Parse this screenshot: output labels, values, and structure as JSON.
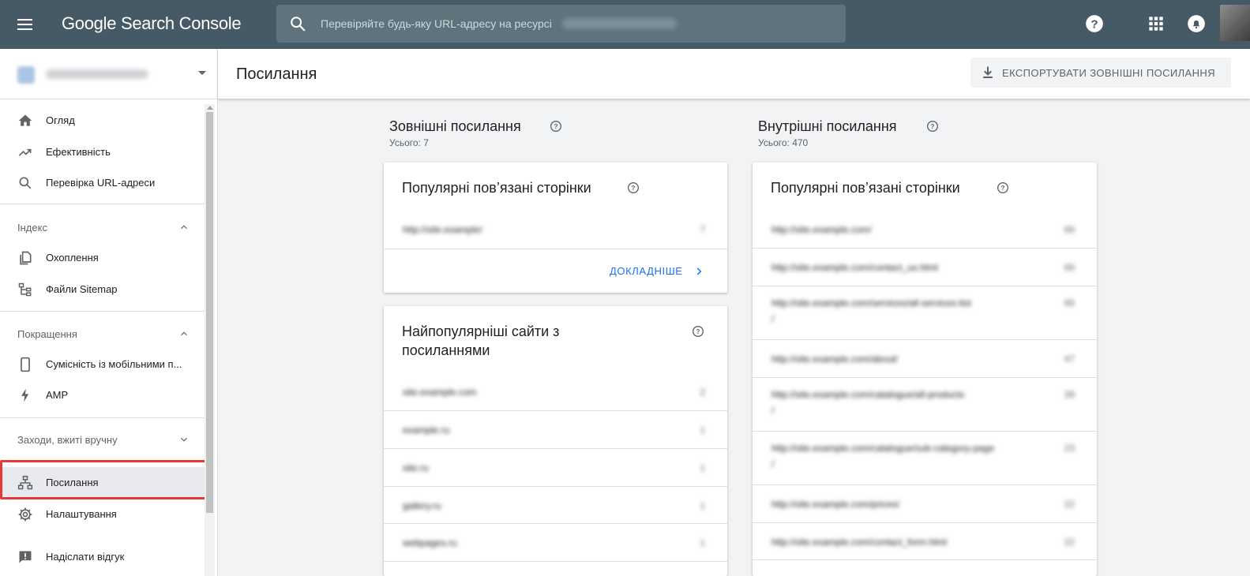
{
  "topbar": {
    "product_name": "Google Search Console",
    "search_placeholder": "Перевіряйте будь-яку URL-адресу на ресурсі"
  },
  "sidebar": {
    "items_main": [
      {
        "label": "Огляд",
        "icon": "home-icon"
      },
      {
        "label": "Ефективність",
        "icon": "trending-up-icon"
      },
      {
        "label": "Перевірка URL-адреси",
        "icon": "search-icon"
      }
    ],
    "section_index": {
      "label": "Індекс",
      "items": [
        {
          "label": "Охоплення",
          "icon": "copy-pages-icon"
        },
        {
          "label": "Файли Sitemap",
          "icon": "sitemap-icon"
        }
      ]
    },
    "section_enhancements": {
      "label": "Покращення",
      "items": [
        {
          "label": "Сумісність із мобільними п...",
          "icon": "smartphone-icon"
        },
        {
          "label": "AMP",
          "icon": "bolt-icon"
        }
      ]
    },
    "section_manual": {
      "label": "Заходи, вжиті вручну"
    },
    "items_bottom": [
      {
        "label": "Посилання",
        "icon": "links-icon",
        "active": true
      },
      {
        "label": "Налаштування",
        "icon": "gear-icon"
      },
      {
        "label": "Надіслати відгук",
        "icon": "feedback-icon"
      }
    ]
  },
  "page": {
    "title": "Посилання",
    "export_label": "ЕКСПОРТУВАТИ ЗОВНІШНІ ПОСИЛАННЯ"
  },
  "external": {
    "title": "Зовнішні посилання",
    "total": "Усього: 7",
    "top_pages": {
      "title": "Популярні пов’язані сторінки",
      "rows": [
        {
          "url": "http://site.example/",
          "count": "7"
        }
      ],
      "more_label": "ДОКЛАДНІШЕ"
    },
    "top_sites": {
      "title_line1": "Найпопулярніші сайти з",
      "title_line2": "посиланнями",
      "rows": [
        {
          "url": "site.example.com",
          "count": "2"
        },
        {
          "url": "example.ru",
          "count": "1"
        },
        {
          "url": "site.ru",
          "count": "1"
        },
        {
          "url": "gallery.ru",
          "count": "1"
        },
        {
          "url": "webpages.ru",
          "count": "1"
        }
      ]
    }
  },
  "internal": {
    "title": "Внутрішні посилання",
    "total": "Усього: 470",
    "top_pages": {
      "title": "Популярні пов’язані сторінки",
      "rows": [
        {
          "url": "http://site.example.com/",
          "count": "66",
          "count_tall": false
        },
        {
          "url": "http://site.example.com/contact_us.html",
          "count": "66",
          "count_tall": false
        },
        {
          "url": "http://site.example.com/services/all-services-list",
          "url_2": "/",
          "count": "66",
          "count_tall": true
        },
        {
          "url": "http://site.example.com/about/",
          "count": "47",
          "count_tall": false
        },
        {
          "url": "http://site.example.com/catalogue/all-products",
          "url_2": "/",
          "count": "39",
          "count_tall": true
        },
        {
          "url": "http://site.example.com/catalogue/sub-category-page",
          "url_2": "/",
          "count": "23",
          "count_tall": true
        },
        {
          "url": "http://site.example.com/prices/",
          "count": "22",
          "count_tall": false
        },
        {
          "url": "http://site.example.com/contact_form.html",
          "count": "22",
          "count_tall": false
        }
      ]
    }
  },
  "colors": {
    "topbar": "#455a64",
    "accent_link": "#1a73e8",
    "highlight": "#e53935"
  }
}
